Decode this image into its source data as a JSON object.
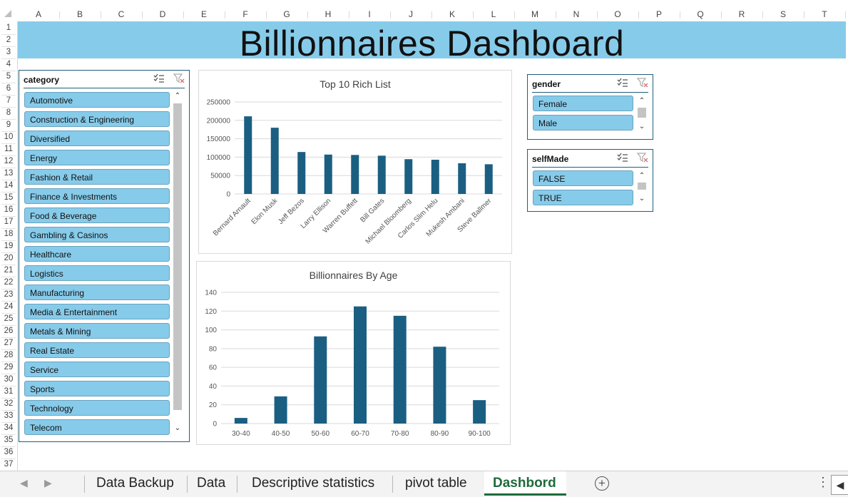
{
  "title": "Billionnaires Dashboard",
  "columns": [
    "A",
    "B",
    "C",
    "D",
    "E",
    "F",
    "G",
    "H",
    "I",
    "J",
    "K",
    "L",
    "M",
    "N",
    "O",
    "P",
    "Q",
    "R",
    "S",
    "T"
  ],
  "rows": [
    "1",
    "2",
    "3",
    "4",
    "5",
    "6",
    "7",
    "8",
    "9",
    "10",
    "11",
    "12",
    "13",
    "14",
    "15",
    "16",
    "17",
    "18",
    "19",
    "20",
    "21",
    "22",
    "23",
    "24",
    "25",
    "26",
    "27",
    "28",
    "29",
    "30",
    "31",
    "32",
    "33",
    "34",
    "35",
    "36",
    "37"
  ],
  "category_slicer": {
    "header": "category",
    "items": [
      "Automotive",
      "Construction & Engineering",
      "Diversified",
      "Energy",
      "Fashion & Retail",
      "Finance & Investments",
      "Food & Beverage",
      "Gambling & Casinos",
      "Healthcare",
      "Logistics",
      "Manufacturing",
      "Media & Entertainment",
      "Metals & Mining",
      "Real Estate",
      "Service",
      "Sports",
      "Technology",
      "Telecom"
    ]
  },
  "gender_slicer": {
    "header": "gender",
    "items": [
      "Female",
      "Male"
    ]
  },
  "selfmade_slicer": {
    "header": "selfMade",
    "items": [
      "FALSE",
      "TRUE"
    ]
  },
  "icons": {
    "multi_select": "multi-select-icon",
    "clear_filter": "clear-filter-icon"
  },
  "colors": {
    "banner": "#87cbea",
    "bar": "#1a5f82",
    "slicer_item": "#87cbea",
    "active_tab": "#1d6b3b"
  },
  "chart_data": [
    {
      "type": "bar",
      "title": "Top 10 Rich List",
      "categories": [
        "Bernard Arnault",
        "Elon Musk",
        "Jeff Bezos",
        "Larry Ellison",
        "Warren Buffett",
        "Bill Gates",
        "Michael Bloomberg",
        "Carlos Slim Helu",
        "Mukesh Ambani",
        "Steve Ballmer"
      ],
      "values": [
        211000,
        180000,
        114000,
        107000,
        106000,
        104000,
        94500,
        93000,
        83400,
        80700
      ],
      "yticks": [
        "0",
        "50000",
        "100000",
        "150000",
        "200000",
        "250000"
      ],
      "ylim": [
        0,
        250000
      ],
      "grid": true
    },
    {
      "type": "bar",
      "title": "Billionnaires By Age",
      "categories": [
        "30-40",
        "40-50",
        "50-60",
        "60-70",
        "70-80",
        "80-90",
        "90-100"
      ],
      "values": [
        6,
        29,
        93,
        125,
        115,
        82,
        25
      ],
      "yticks": [
        "0",
        "20",
        "40",
        "60",
        "80",
        "100",
        "120",
        "140"
      ],
      "ylim": [
        0,
        140
      ],
      "grid": true
    }
  ],
  "tabs": [
    "Data Backup",
    "Data",
    "Descriptive statistics",
    "pivot table",
    "Dashbord"
  ],
  "active_tab": "Dashbord"
}
